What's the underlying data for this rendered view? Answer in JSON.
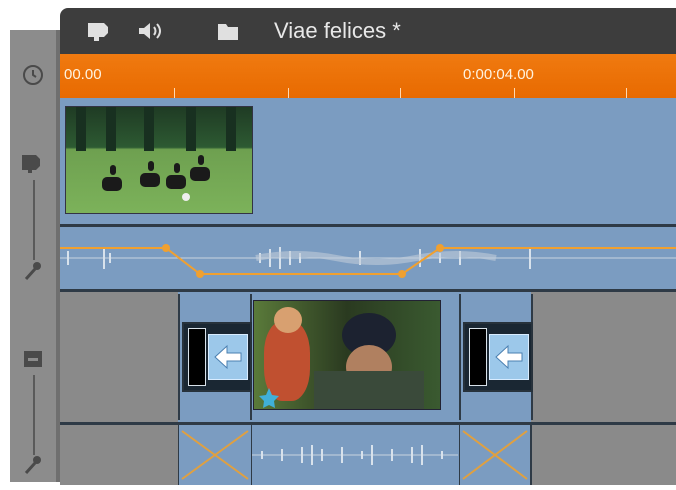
{
  "project": {
    "title": "Viae felices *"
  },
  "ruler": {
    "start_label": "00.00",
    "mid_label": "0:00:04.00"
  },
  "toolbar": {
    "icons": [
      "video-camera-icon",
      "speaker-icon",
      "folder-icon"
    ]
  },
  "gutter": {
    "icons": [
      "clock-icon",
      "video-camera-icon",
      "microphone-icon",
      "title-track-icon",
      "microphone-icon"
    ]
  },
  "colors": {
    "ruler": "#e86a00",
    "track": "#7b9cc1",
    "titlebar": "#3d3d3d",
    "volume_line": "#f0a030"
  }
}
